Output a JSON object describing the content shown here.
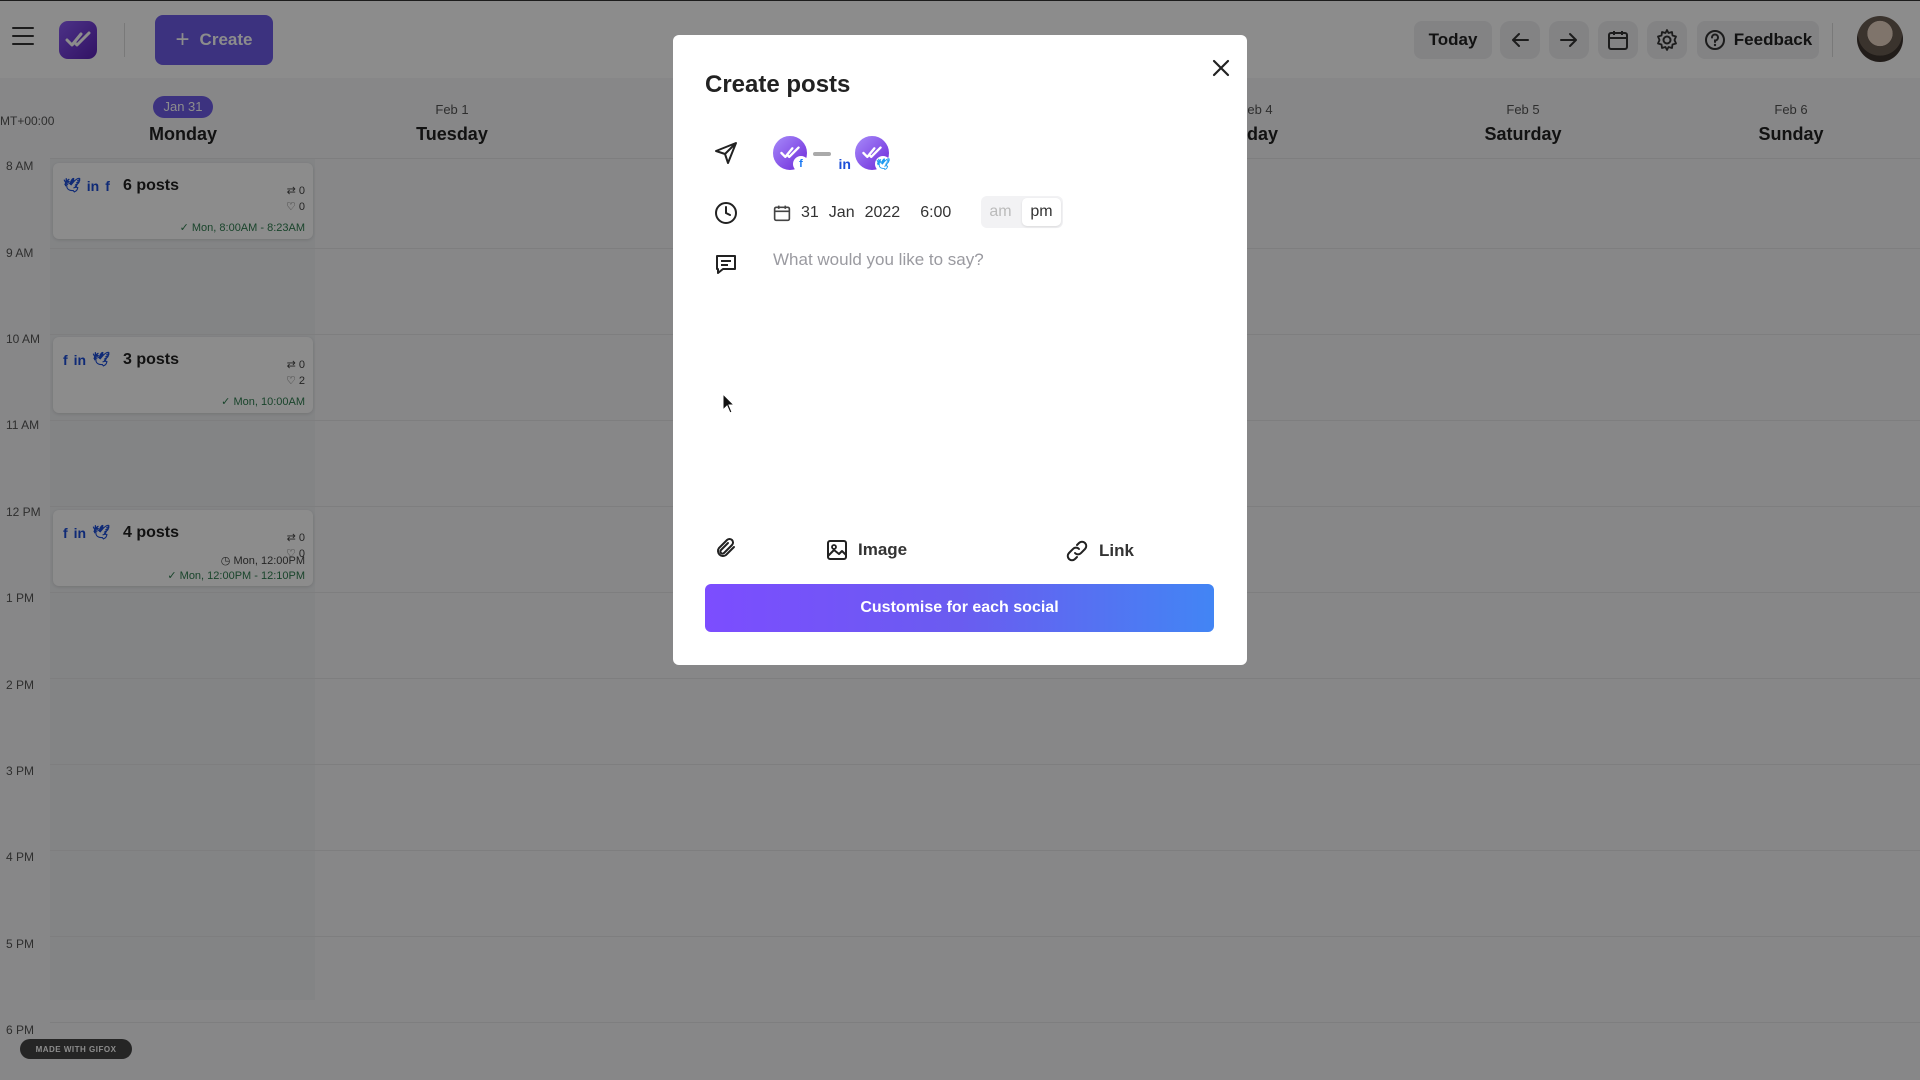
{
  "topbar": {
    "create_label": "Create",
    "today_label": "Today",
    "feedback_label": "Feedback"
  },
  "calendar": {
    "timezone": "MT+00:00",
    "days": [
      {
        "date": "Jan 31",
        "name": "Monday",
        "current": true
      },
      {
        "date": "Feb 1",
        "name": "Tuesday",
        "current": false
      },
      {
        "date": "eb 4",
        "name": "iday",
        "current": false
      },
      {
        "date": "Feb 5",
        "name": "Saturday",
        "current": false
      },
      {
        "date": "Feb 6",
        "name": "Sunday",
        "current": false
      }
    ],
    "hours": [
      "8 AM",
      "9 AM",
      "10 AM",
      "11 AM",
      "12 PM",
      "1 PM",
      "2 PM",
      "3 PM",
      "4 PM",
      "5 PM",
      "6 PM"
    ],
    "posts": [
      {
        "title": "6 posts",
        "retweets": "0",
        "likes": "0",
        "time": "Mon, 8:00AM - 8:23AM"
      },
      {
        "title": "3 posts",
        "retweets": "0",
        "likes": "2",
        "time": "Mon, 10:00AM"
      },
      {
        "title": "4 posts",
        "retweets": "0",
        "likes": "0",
        "scheduled": "Mon, 12:00PM",
        "time": "Mon, 12:00PM - 12:10PM"
      }
    ]
  },
  "watermark": "MADE WITH GIFOX",
  "modal": {
    "title": "Create posts",
    "date_day": "31",
    "date_month": "Jan",
    "date_year": "2022",
    "time": "6:00",
    "am_label": "am",
    "pm_label": "pm",
    "message_placeholder": "What would you like to say?",
    "image_label": "Image",
    "link_label": "Link",
    "customise_label": "Customise for each social",
    "accounts": [
      {
        "network": "facebook",
        "badge": "f"
      },
      {
        "network": "linkedin",
        "badge": "in"
      },
      {
        "network": "twitter",
        "badge": "t"
      }
    ]
  },
  "colors": {
    "accent": "#6d5ce8",
    "twitter": "#1d9bf0",
    "linkedin": "#0a66c2",
    "facebook": "#1877f2"
  }
}
